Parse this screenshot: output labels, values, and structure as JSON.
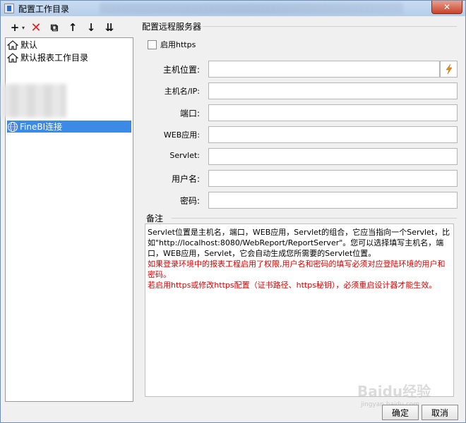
{
  "window": {
    "title": "配置工作目录",
    "close_label": "✕"
  },
  "toolbar": {
    "add": "+",
    "add_caret": "▾",
    "delete": "✕",
    "copy": "⧉",
    "up": "↑",
    "down": "↓",
    "download": "⇊"
  },
  "tree": {
    "items": [
      {
        "label": "默认"
      },
      {
        "label": "默认报表工作目录"
      },
      {
        "label": "FineBI连接"
      }
    ]
  },
  "form": {
    "section_title": "配置远程服务器",
    "enable_https_label": "启用https",
    "fields": [
      {
        "label": "主机位置:",
        "value": ""
      },
      {
        "label": "主机名/IP:",
        "value": ""
      },
      {
        "label": "端口:",
        "value": ""
      },
      {
        "label": "WEB应用:",
        "value": ""
      },
      {
        "label": "Servlet:",
        "value": ""
      },
      {
        "label": "用户名:",
        "value": ""
      },
      {
        "label": "密码:",
        "value": ""
      }
    ]
  },
  "notes": {
    "title": "备注",
    "line1": "Servlet位置是主机名，端口，WEB应用，Servlet的组合，它应当指向一个Servlet，比如\"http://localhost:8080/WebReport/ReportServer\"。您可以选择填写主机名，端口，WEB应用，Servlet，它会自动生成您所需要的Servlet位置。",
    "line2": "如果登录环境中的报表工程启用了权限,用户名和密码的填写必须对应登陆环境的用户和密码。",
    "line3": "若启用https或修改https配置（证书路径、https秘钥），必须重启设计器才能生效。"
  },
  "buttons": {
    "ok": "确定",
    "cancel": "取消"
  },
  "watermark": {
    "text": "Baidu经验",
    "sub": "jingyan.baidu.com"
  },
  "colors": {
    "selection": "#3a8ae6",
    "notes_red": "#dd0000"
  }
}
